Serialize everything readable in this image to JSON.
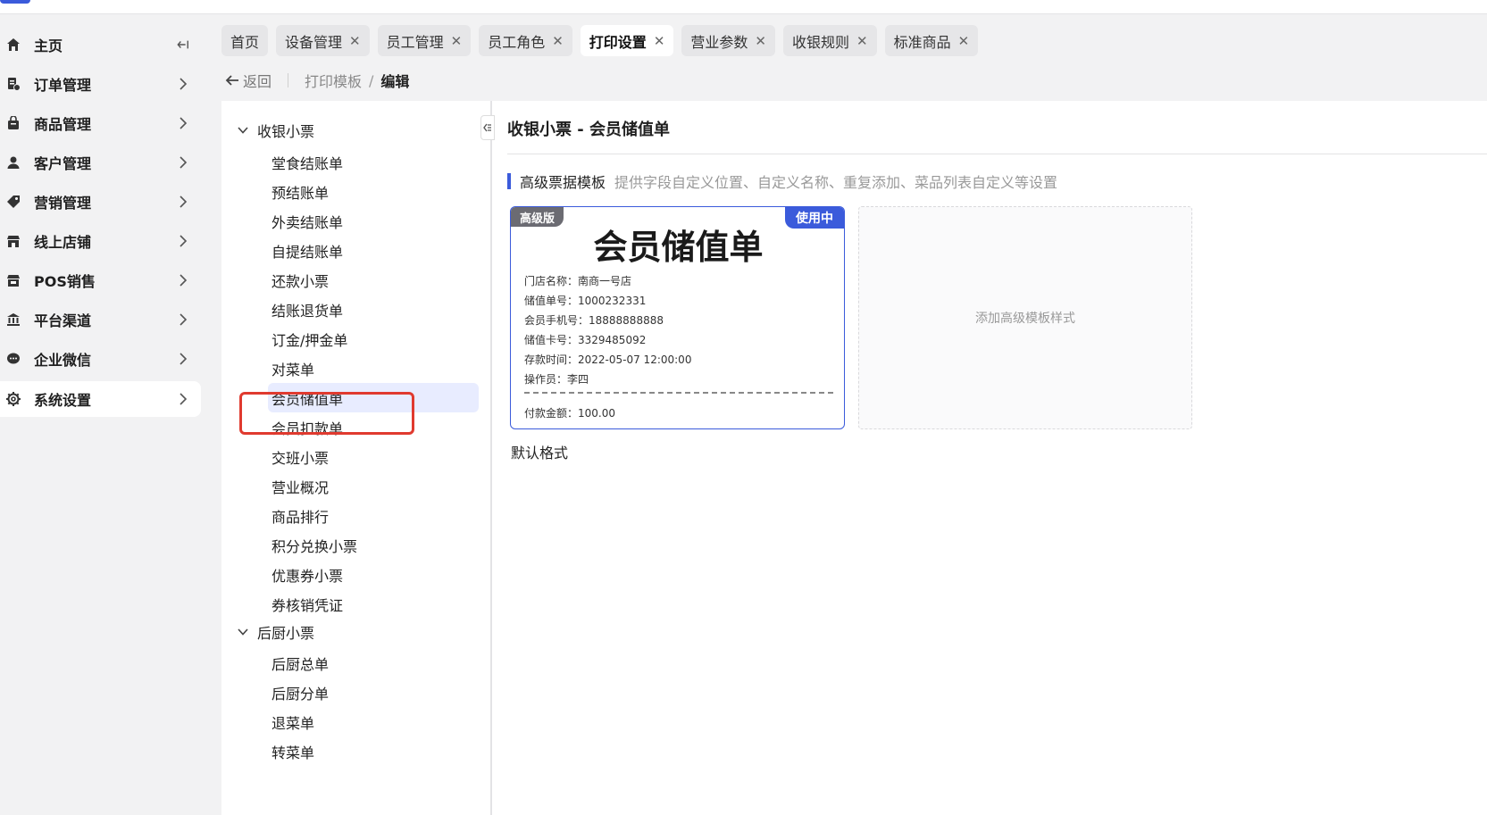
{
  "sidebar": {
    "items": [
      {
        "label": "主页",
        "icon": "home-icon"
      },
      {
        "label": "订单管理",
        "icon": "order-icon"
      },
      {
        "label": "商品管理",
        "icon": "goods-icon"
      },
      {
        "label": "客户管理",
        "icon": "user-icon"
      },
      {
        "label": "营销管理",
        "icon": "tag-icon"
      },
      {
        "label": "线上店铺",
        "icon": "store-icon"
      },
      {
        "label": "POS销售",
        "icon": "pos-icon"
      },
      {
        "label": "平台渠道",
        "icon": "bank-icon"
      },
      {
        "label": "企业微信",
        "icon": "chat-icon"
      },
      {
        "label": "系统设置",
        "icon": "gear-icon",
        "active": true
      }
    ]
  },
  "tabs": [
    {
      "label": "首页",
      "closable": false
    },
    {
      "label": "设备管理",
      "closable": true
    },
    {
      "label": "员工管理",
      "closable": true
    },
    {
      "label": "员工角色",
      "closable": true
    },
    {
      "label": "打印设置",
      "closable": true,
      "active": true
    },
    {
      "label": "营业参数",
      "closable": true
    },
    {
      "label": "收银规则",
      "closable": true
    },
    {
      "label": "标准商品",
      "closable": true
    }
  ],
  "breadcrumb": {
    "back": "返回",
    "parent": "打印模板",
    "separator": "/",
    "current": "编辑"
  },
  "tree": {
    "groups": [
      {
        "label": "收银小票",
        "items": [
          "堂食结账单",
          "预结账单",
          "外卖结账单",
          "自提结账单",
          "还款小票",
          "结账退货单",
          "订金/押金单",
          "对菜单",
          "会员储值单",
          "会员扣款单",
          "交班小票",
          "营业概况",
          "商品排行",
          "积分兑换小票",
          "优惠券小票",
          "券核销凭证"
        ]
      },
      {
        "label": "后厨小票",
        "items": [
          "后厨总单",
          "后厨分单",
          "退菜单",
          "转菜单"
        ]
      }
    ],
    "selected": "会员储值单"
  },
  "content": {
    "title": "收银小票 - 会员储值单",
    "section_title": "高级票据模板",
    "section_desc": "提供字段自定义位置、自定义名称、重复添加、菜品列表自定义等设置",
    "card": {
      "badge_left": "高级版",
      "badge_right": "使用中",
      "receipt_title": "会员储值单",
      "lines": [
        "门店名称：南商一号店",
        "储值单号：1000232331",
        "会员手机号：18888888888",
        "储值卡号：3329485092",
        "存款时间：2022-05-07 12:00:00",
        "操作员：李四"
      ],
      "pay_line": "付款金额：100.00",
      "caption": "默认格式"
    },
    "add_label": "添加高级模板样式"
  },
  "colors": {
    "accent": "#3b5bdb",
    "highlight": "#e03a2f",
    "selected_bg": "#e8ecff"
  }
}
